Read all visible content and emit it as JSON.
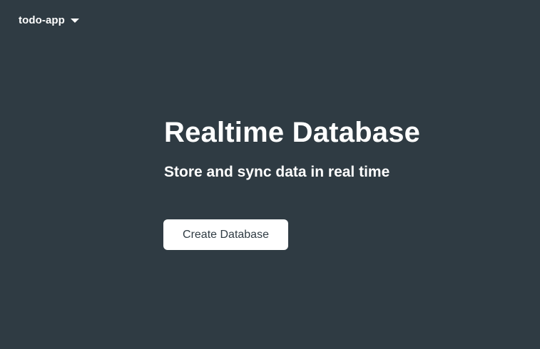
{
  "header": {
    "project_name": "todo-app",
    "dropdown_icon": "caret-down-icon"
  },
  "hero": {
    "title": "Realtime Database",
    "subtitle": "Store and sync data in real time",
    "cta_label": "Create Database"
  },
  "colors": {
    "background": "#2f3b43",
    "text": "#ffffff",
    "button_background": "#ffffff",
    "button_text": "#2f3b43"
  }
}
